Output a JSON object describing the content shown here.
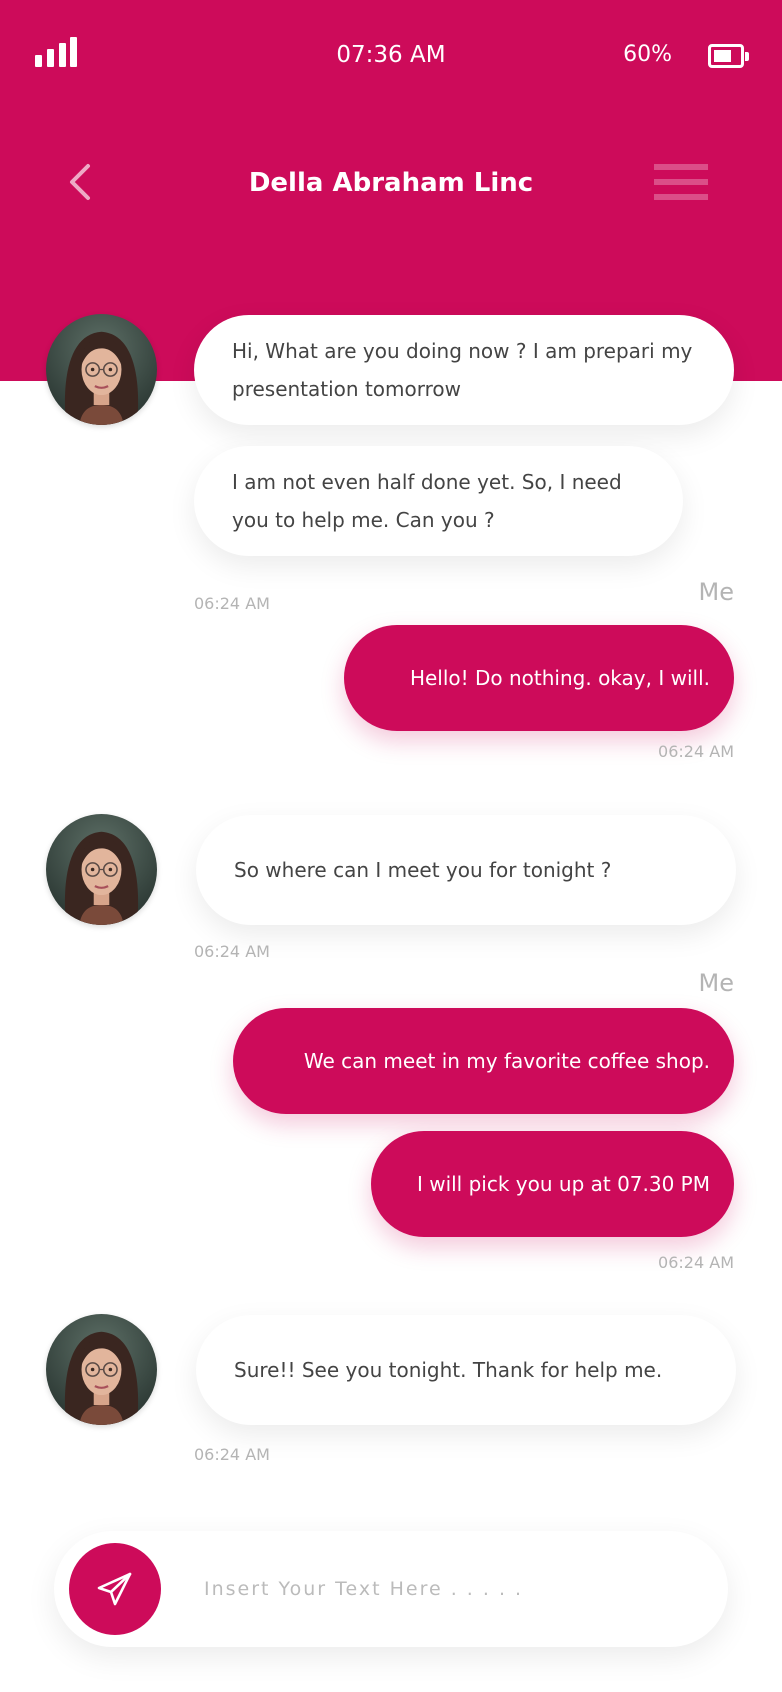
{
  "status_bar": {
    "time": "07:36 AM",
    "battery": "60%"
  },
  "header": {
    "title": "Della Abraham Linc"
  },
  "icons": {
    "back": "chevron-left-icon",
    "menu": "hamburger-menu-icon",
    "send": "paper-plane-icon",
    "signal": "signal-bars-icon",
    "battery": "battery-icon"
  },
  "colors": {
    "accent": "#cd0b5a",
    "bubble_in": "#ffffff",
    "timestamp": "#b4b4b4"
  },
  "messages": [
    {
      "sender": "contact",
      "text": "Hi, What are you doing now ? I am prepari my presentation tomorrow"
    },
    {
      "sender": "contact",
      "text": "I am not even half done yet. So, I need you to help me. Can you ?"
    },
    {
      "time": "06:24 AM"
    },
    {
      "sender": "me",
      "label": "Me",
      "text": "Hello! Do nothing.  okay, I will.",
      "time": "06:24 AM"
    },
    {
      "sender": "contact",
      "text": "So where can I meet you for tonight ?",
      "time": "06:24 AM"
    },
    {
      "sender": "me",
      "label": "Me",
      "text": "We can meet in my favorite coffee shop."
    },
    {
      "sender": "me",
      "text": "I will pick you up at 07.30 PM",
      "time": "06:24 AM"
    },
    {
      "sender": "contact",
      "text": "Sure!! See you tonight. Thank for help me.",
      "time": "06:24 AM"
    }
  ],
  "composer": {
    "placeholder": "Insert Your Text Here . . . . ."
  }
}
